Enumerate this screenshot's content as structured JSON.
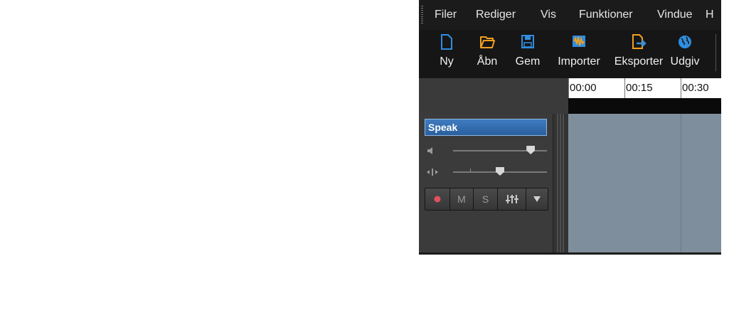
{
  "menu": {
    "items": [
      {
        "label": "Filer"
      },
      {
        "label": "Rediger"
      },
      {
        "label": "Vis"
      },
      {
        "label": "Funktioner"
      },
      {
        "label": "Vindue"
      },
      {
        "label": "H"
      }
    ]
  },
  "toolbar": {
    "buttons": [
      {
        "label": "Ny",
        "icon": "new-file-icon"
      },
      {
        "label": "Åbn",
        "icon": "open-folder-icon"
      },
      {
        "label": "Gem",
        "icon": "save-icon"
      },
      {
        "label": "Importer",
        "icon": "import-audio-icon"
      },
      {
        "label": "Eksporter",
        "icon": "export-icon"
      },
      {
        "label": "Udgiv",
        "icon": "globe-icon"
      }
    ]
  },
  "ruler": {
    "ticks": [
      "00:00",
      "00:15",
      "00:30"
    ]
  },
  "track": {
    "name": "Speak",
    "volume_level": 0.86,
    "pan_level": 0.5,
    "buttons": {
      "record_icon": "record-icon",
      "mute_label": "M",
      "solo_label": "S",
      "effects_icon": "mixer-icon",
      "menu_icon": "dropdown-arrow-icon"
    }
  },
  "colors": {
    "accent_blue": "#2e6fb5",
    "track_lane": "#7f8e9c",
    "record_red": "#e05060",
    "toolbar_orange": "#f0a020",
    "toolbar_blue": "#2f8de0"
  }
}
